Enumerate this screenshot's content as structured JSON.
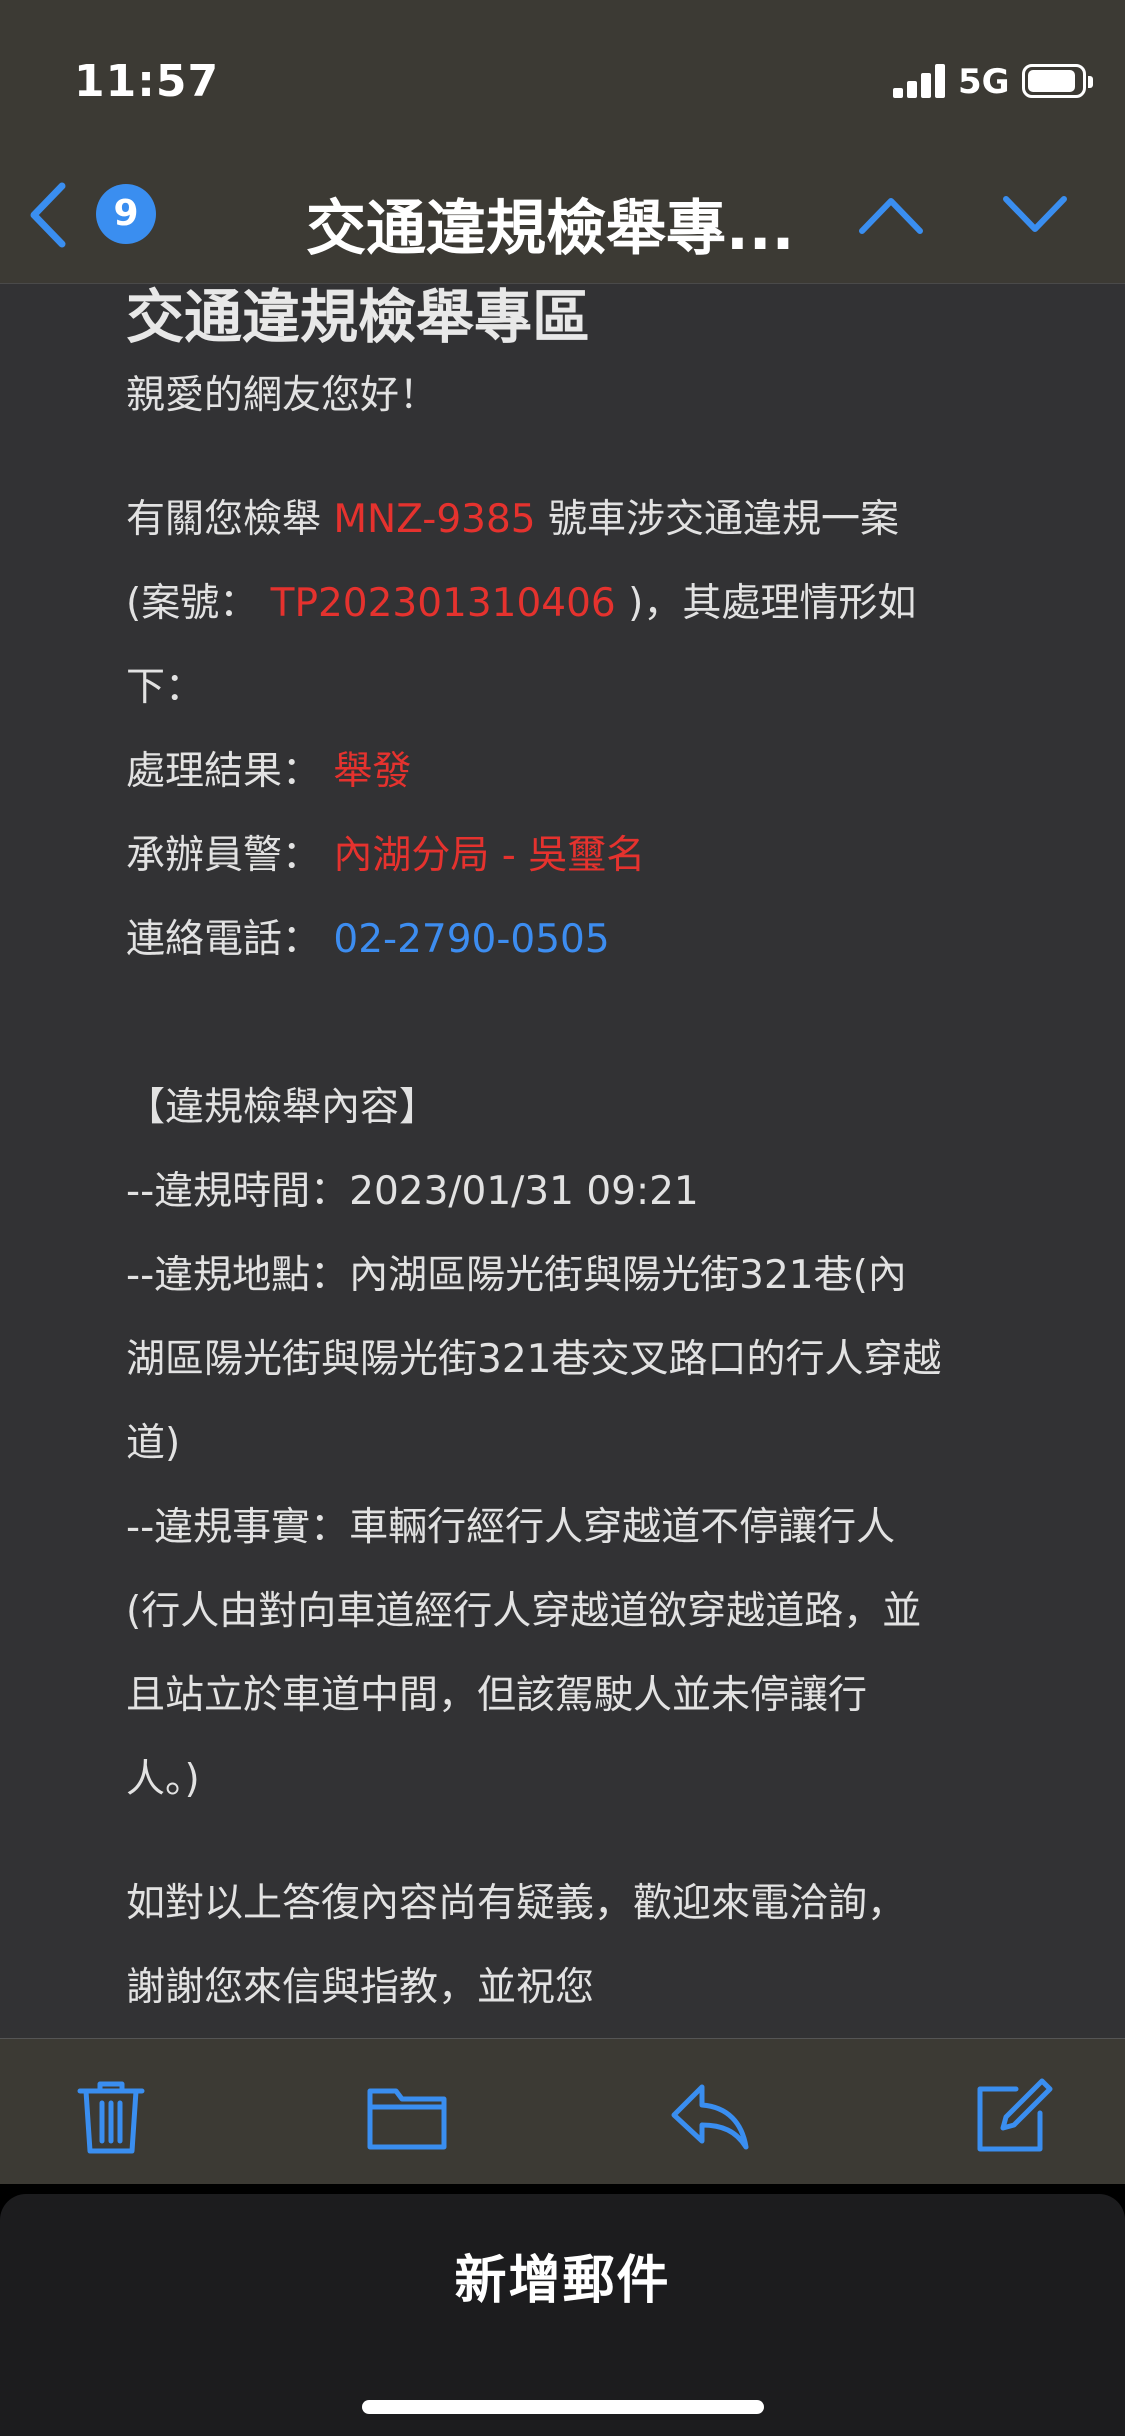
{
  "status_bar": {
    "time": "11:57",
    "network": "5G"
  },
  "nav": {
    "back_count": "9",
    "title": "交通違規檢舉專...",
    "back_icon": "chevron-left-icon",
    "prev_icon": "chevron-up-icon",
    "next_icon": "chevron-down-icon"
  },
  "email": {
    "heading": "交通違規檢舉專區",
    "greeting": "親愛的網友您好！",
    "intro_prefix": "有關您檢舉 ",
    "plate": "MNZ-9385",
    "intro_suffix": " 號車涉交通違規一案",
    "case_prefix": "(案號： ",
    "case_number": "TP202301310406",
    "case_suffix": " )，其處理情形如",
    "case_tail": "下：",
    "result_label": "處理結果： ",
    "result_value": "舉發",
    "officer_label": "承辦員警： ",
    "officer_value": "內湖分局 - 吳璽名",
    "phone_label": "連絡電話： ",
    "phone_value": "02-2790-0505",
    "section_title": "【違規檢舉內容】",
    "time_line": "--違規時間：2023/01/31 09:21",
    "location_line1": "--違規地點：內湖區陽光街與陽光街321巷(內",
    "location_line2": "湖區陽光街與陽光街321巷交叉路口的行人穿越",
    "location_line3": "道)",
    "fact_line1": "--違規事實：車輛行經行人穿越道不停讓行人",
    "fact_line2": "(行人由對向車道經行人穿越道欲穿越道路，並",
    "fact_line3": "且站立於車道中間，但該駕駛人並未停讓行",
    "fact_line4": "人。)",
    "closing_line1": "如對以上答復內容尚有疑義，歡迎來電洽詢，",
    "closing_line2": "謝謝您來信與指教，並祝您"
  },
  "toolbar": {
    "icons": [
      "trash-icon",
      "folder-icon",
      "reply-icon",
      "compose-icon"
    ]
  },
  "compose_sheet": {
    "title": "新增郵件"
  },
  "colors": {
    "accent": "#3a8ef0",
    "highlight_red": "#e5322e",
    "bar_background": "#3c3a34",
    "mail_background": "#323234"
  }
}
